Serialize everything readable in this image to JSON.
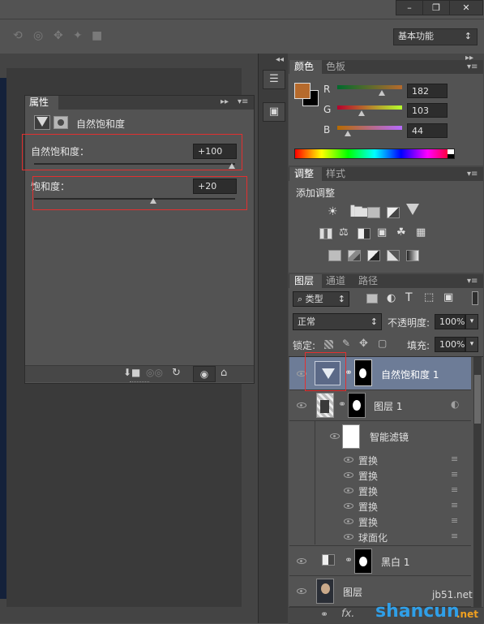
{
  "window": {
    "minimize_icon": "minimize-icon",
    "restore_icon": "restore-icon",
    "close_icon": "close-icon"
  },
  "options_bar": {
    "workspace": "基本功能"
  },
  "properties_panel": {
    "tab": "属性",
    "header_title": "自然饱和度",
    "vibrance": {
      "label": "自然饱和度：",
      "value": "+100",
      "pct": 1.0
    },
    "saturation": {
      "label": "饱和度：",
      "value": "+20",
      "pct": 0.6
    }
  },
  "color_panel": {
    "tabs": [
      "颜色",
      "色板"
    ],
    "fg_color": "#b66a2c",
    "channels": [
      {
        "label": "R",
        "value": "182"
      },
      {
        "label": "G",
        "value": "103"
      },
      {
        "label": "B",
        "value": "44"
      }
    ]
  },
  "adjustments_panel": {
    "tabs": [
      "调整",
      "样式"
    ],
    "title": "添加调整"
  },
  "layers_panel": {
    "tabs": [
      "图层",
      "通道",
      "路径"
    ],
    "filter_kind": "类型",
    "blend_mode": "正常",
    "opacity_label": "不透明度:",
    "opacity_value": "100%",
    "lock_label": "锁定:",
    "fill_label": "填充:",
    "fill_value": "100%",
    "layers": [
      {
        "name": "自然饱和度 1",
        "selected": true
      },
      {
        "name": "图层 1",
        "selected": false
      },
      {
        "name": "黑白 1",
        "selected": false
      },
      {
        "name": "图层",
        "selected": false
      }
    ],
    "smart_filter_label": "智能滤镜",
    "filters": [
      "置换",
      "置换",
      "置换",
      "置换",
      "置换",
      "球面化"
    ]
  },
  "watermark": {
    "site": "jb51.net",
    "brand": "shancun",
    "domain": ".net"
  }
}
